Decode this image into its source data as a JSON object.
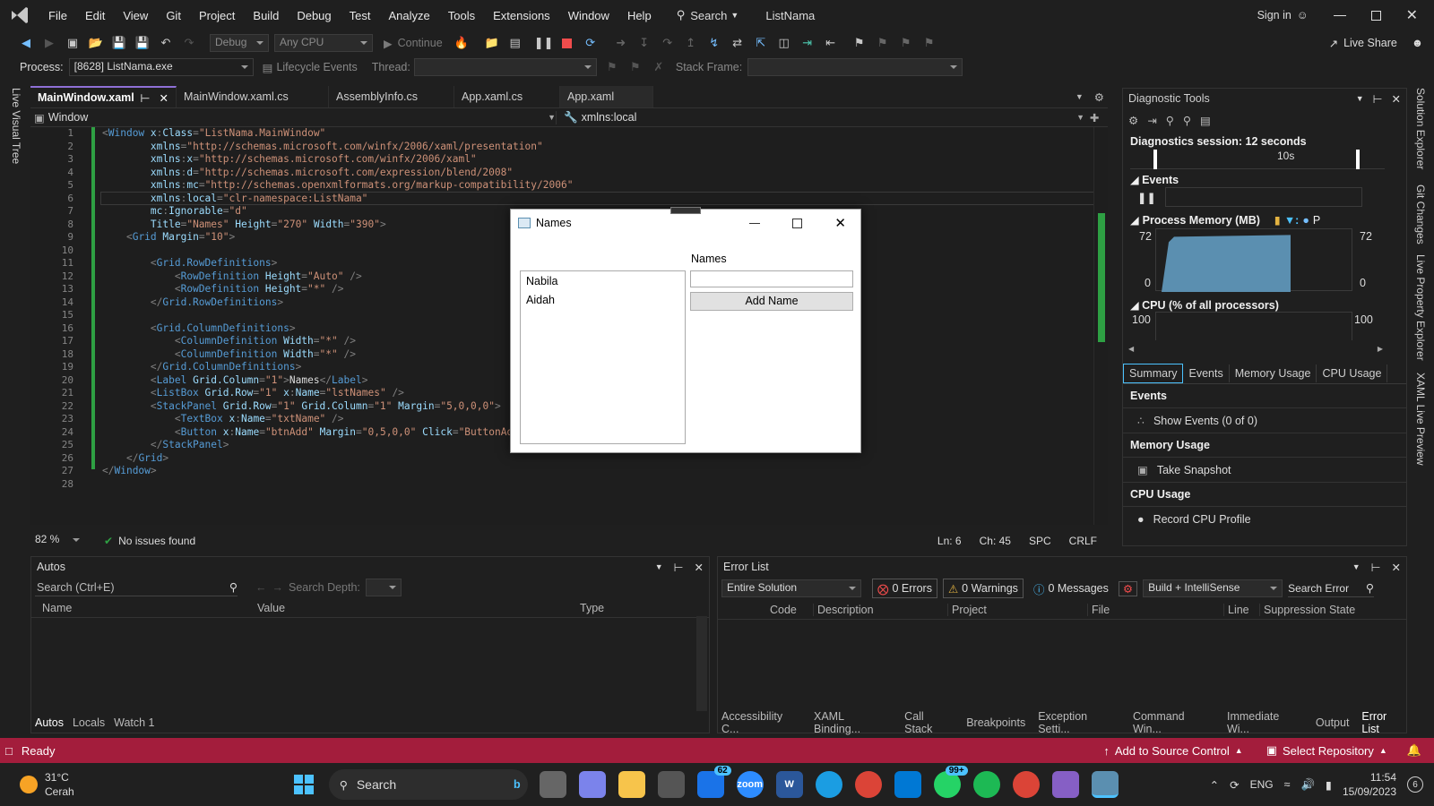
{
  "menu": [
    "File",
    "Edit",
    "View",
    "Git",
    "Project",
    "Build",
    "Debug",
    "Test",
    "Analyze",
    "Tools",
    "Extensions",
    "Window",
    "Help"
  ],
  "search_label": "Search",
  "solution_name": "ListNama",
  "sign_in": "Sign in",
  "live_share": "Live Share",
  "toolbar": {
    "config": "Debug",
    "platform": "Any CPU",
    "continue": "Continue"
  },
  "process_bar": {
    "process_label": "Process:",
    "process_value": "[8628] ListNama.exe",
    "lifecycle": "Lifecycle Events",
    "thread": "Thread:",
    "stack_frame": "Stack Frame:"
  },
  "left_strip": "Live Visual Tree",
  "tabs": [
    "MainWindow.xaml",
    "MainWindow.xaml.cs",
    "AssemblyInfo.cs",
    "App.xaml.cs",
    "App.xaml"
  ],
  "nav": {
    "left": "Window",
    "right": "xmlns:local"
  },
  "code_lines": [
    [
      [
        "t-p",
        "<"
      ],
      [
        "t-el",
        "Window "
      ],
      [
        "t-at",
        "x"
      ],
      [
        "t-p",
        ":"
      ],
      [
        "t-at",
        "Class"
      ],
      [
        "t-p",
        "="
      ],
      [
        "t-val",
        "\"ListNama.MainWindow\""
      ]
    ],
    [
      [
        "t-txt",
        "        "
      ],
      [
        "t-at",
        "xmlns"
      ],
      [
        "t-p",
        "="
      ],
      [
        "t-val",
        "\"http://schemas.microsoft.com/winfx/2006/xaml/presentation\""
      ]
    ],
    [
      [
        "t-txt",
        "        "
      ],
      [
        "t-at",
        "xmlns"
      ],
      [
        "t-p",
        ":"
      ],
      [
        "t-at",
        "x"
      ],
      [
        "t-p",
        "="
      ],
      [
        "t-val",
        "\"http://schemas.microsoft.com/winfx/2006/xaml\""
      ]
    ],
    [
      [
        "t-txt",
        "        "
      ],
      [
        "t-at",
        "xmlns"
      ],
      [
        "t-p",
        ":"
      ],
      [
        "t-at",
        "d"
      ],
      [
        "t-p",
        "="
      ],
      [
        "t-val",
        "\"http://schemas.microsoft.com/expression/blend/2008\""
      ]
    ],
    [
      [
        "t-txt",
        "        "
      ],
      [
        "t-at",
        "xmlns"
      ],
      [
        "t-p",
        ":"
      ],
      [
        "t-at",
        "mc"
      ],
      [
        "t-p",
        "="
      ],
      [
        "t-val",
        "\"http://schemas.openxmlformats.org/markup-compatibility/2006\""
      ]
    ],
    [
      [
        "t-txt",
        "        "
      ],
      [
        "t-at",
        "xmlns"
      ],
      [
        "t-p",
        ":"
      ],
      [
        "t-at",
        "local"
      ],
      [
        "t-p",
        "="
      ],
      [
        "t-val",
        "\"clr-namespace:ListNama\""
      ]
    ],
    [
      [
        "t-txt",
        "        "
      ],
      [
        "t-at",
        "mc"
      ],
      [
        "t-p",
        ":"
      ],
      [
        "t-at",
        "Ignorable"
      ],
      [
        "t-p",
        "="
      ],
      [
        "t-val",
        "\"d\""
      ]
    ],
    [
      [
        "t-txt",
        "        "
      ],
      [
        "t-at",
        "Title"
      ],
      [
        "t-p",
        "="
      ],
      [
        "t-val",
        "\"Names\""
      ],
      [
        "t-txt",
        " "
      ],
      [
        "t-at",
        "Height"
      ],
      [
        "t-p",
        "="
      ],
      [
        "t-val",
        "\"270\""
      ],
      [
        "t-txt",
        " "
      ],
      [
        "t-at",
        "Width"
      ],
      [
        "t-p",
        "="
      ],
      [
        "t-val",
        "\"390\""
      ],
      [
        "t-p",
        ">"
      ]
    ],
    [
      [
        "t-txt",
        "    "
      ],
      [
        "t-p",
        "<"
      ],
      [
        "t-el",
        "Grid "
      ],
      [
        "t-at",
        "Margin"
      ],
      [
        "t-p",
        "="
      ],
      [
        "t-val",
        "\"10\""
      ],
      [
        "t-p",
        ">"
      ]
    ],
    [],
    [
      [
        "t-txt",
        "        "
      ],
      [
        "t-p",
        "<"
      ],
      [
        "t-el",
        "Grid.RowDefinitions"
      ],
      [
        "t-p",
        ">"
      ]
    ],
    [
      [
        "t-txt",
        "            "
      ],
      [
        "t-p",
        "<"
      ],
      [
        "t-el",
        "RowDefinition "
      ],
      [
        "t-at",
        "Height"
      ],
      [
        "t-p",
        "="
      ],
      [
        "t-val",
        "\"Auto\""
      ],
      [
        "t-p",
        " />"
      ]
    ],
    [
      [
        "t-txt",
        "            "
      ],
      [
        "t-p",
        "<"
      ],
      [
        "t-el",
        "RowDefinition "
      ],
      [
        "t-at",
        "Height"
      ],
      [
        "t-p",
        "="
      ],
      [
        "t-val",
        "\"*\""
      ],
      [
        "t-p",
        " />"
      ]
    ],
    [
      [
        "t-txt",
        "        "
      ],
      [
        "t-p",
        "</"
      ],
      [
        "t-el",
        "Grid.RowDefinitions"
      ],
      [
        "t-p",
        ">"
      ]
    ],
    [],
    [
      [
        "t-txt",
        "        "
      ],
      [
        "t-p",
        "<"
      ],
      [
        "t-el",
        "Grid.ColumnDefinitions"
      ],
      [
        "t-p",
        ">"
      ]
    ],
    [
      [
        "t-txt",
        "            "
      ],
      [
        "t-p",
        "<"
      ],
      [
        "t-el",
        "ColumnDefinition "
      ],
      [
        "t-at",
        "Width"
      ],
      [
        "t-p",
        "="
      ],
      [
        "t-val",
        "\"*\""
      ],
      [
        "t-p",
        " />"
      ]
    ],
    [
      [
        "t-txt",
        "            "
      ],
      [
        "t-p",
        "<"
      ],
      [
        "t-el",
        "ColumnDefinition "
      ],
      [
        "t-at",
        "Width"
      ],
      [
        "t-p",
        "="
      ],
      [
        "t-val",
        "\"*\""
      ],
      [
        "t-p",
        " />"
      ]
    ],
    [
      [
        "t-txt",
        "        "
      ],
      [
        "t-p",
        "</"
      ],
      [
        "t-el",
        "Grid.ColumnDefinitions"
      ],
      [
        "t-p",
        ">"
      ]
    ],
    [
      [
        "t-txt",
        "        "
      ],
      [
        "t-p",
        "<"
      ],
      [
        "t-el",
        "Label "
      ],
      [
        "t-at",
        "Grid.Column"
      ],
      [
        "t-p",
        "="
      ],
      [
        "t-val",
        "\"1\""
      ],
      [
        "t-p",
        ">"
      ],
      [
        "t-txt",
        "Names"
      ],
      [
        "t-p",
        "</"
      ],
      [
        "t-el",
        "Label"
      ],
      [
        "t-p",
        ">"
      ]
    ],
    [
      [
        "t-txt",
        "        "
      ],
      [
        "t-p",
        "<"
      ],
      [
        "t-el",
        "ListBox "
      ],
      [
        "t-at",
        "Grid.Row"
      ],
      [
        "t-p",
        "="
      ],
      [
        "t-val",
        "\"1\""
      ],
      [
        "t-txt",
        " "
      ],
      [
        "t-at",
        "x"
      ],
      [
        "t-p",
        ":"
      ],
      [
        "t-at",
        "Name"
      ],
      [
        "t-p",
        "="
      ],
      [
        "t-val",
        "\"lstNames\""
      ],
      [
        "t-p",
        " />"
      ]
    ],
    [
      [
        "t-txt",
        "        "
      ],
      [
        "t-p",
        "<"
      ],
      [
        "t-el",
        "StackPanel "
      ],
      [
        "t-at",
        "Grid.Row"
      ],
      [
        "t-p",
        "="
      ],
      [
        "t-val",
        "\"1\""
      ],
      [
        "t-txt",
        " "
      ],
      [
        "t-at",
        "Grid.Column"
      ],
      [
        "t-p",
        "="
      ],
      [
        "t-val",
        "\"1\""
      ],
      [
        "t-txt",
        " "
      ],
      [
        "t-at",
        "Margin"
      ],
      [
        "t-p",
        "="
      ],
      [
        "t-val",
        "\"5,0,0,0\""
      ],
      [
        "t-p",
        ">"
      ]
    ],
    [
      [
        "t-txt",
        "            "
      ],
      [
        "t-p",
        "<"
      ],
      [
        "t-el",
        "TextBox "
      ],
      [
        "t-at",
        "x"
      ],
      [
        "t-p",
        ":"
      ],
      [
        "t-at",
        "Name"
      ],
      [
        "t-p",
        "="
      ],
      [
        "t-val",
        "\"txtName\""
      ],
      [
        "t-p",
        " />"
      ]
    ],
    [
      [
        "t-txt",
        "            "
      ],
      [
        "t-p",
        "<"
      ],
      [
        "t-el",
        "Button "
      ],
      [
        "t-at",
        "x"
      ],
      [
        "t-p",
        ":"
      ],
      [
        "t-at",
        "Name"
      ],
      [
        "t-p",
        "="
      ],
      [
        "t-val",
        "\"btnAdd\""
      ],
      [
        "t-txt",
        " "
      ],
      [
        "t-at",
        "Margin"
      ],
      [
        "t-p",
        "="
      ],
      [
        "t-val",
        "\"0,5,0,0\""
      ],
      [
        "t-txt",
        " "
      ],
      [
        "t-at",
        "Click"
      ],
      [
        "t-p",
        "="
      ],
      [
        "t-val",
        "\"ButtonAddN"
      ]
    ],
    [
      [
        "t-txt",
        "        "
      ],
      [
        "t-p",
        "</"
      ],
      [
        "t-el",
        "StackPanel"
      ],
      [
        "t-p",
        ">"
      ]
    ],
    [
      [
        "t-txt",
        "    "
      ],
      [
        "t-p",
        "</"
      ],
      [
        "t-el",
        "Grid"
      ],
      [
        "t-p",
        ">"
      ]
    ],
    [
      [
        "t-p",
        "</"
      ],
      [
        "t-el",
        "Window"
      ],
      [
        "t-p",
        ">"
      ]
    ],
    []
  ],
  "editor_status": {
    "zoom": "82 %",
    "issues": "No issues found",
    "ln": "Ln: 6",
    "ch": "Ch: 45",
    "spc": "SPC",
    "crlf": "CRLF"
  },
  "diag": {
    "title": "Diagnostic Tools",
    "session": "Diagnostics session: 12 seconds",
    "timeline_tick": "10s",
    "events": "Events",
    "process_memory": "Process Memory (MB)",
    "mem_legend_p": "P",
    "mem_max": "72",
    "mem_min": "0",
    "memory_level": 0.88,
    "cpu": "CPU (% of all processors)",
    "cpu_max": "100",
    "tabs": [
      "Summary",
      "Events",
      "Memory Usage",
      "CPU Usage"
    ],
    "sum_events": "Events",
    "show_events": "Show Events (0 of 0)",
    "sum_memory": "Memory Usage",
    "take_snapshot": "Take Snapshot",
    "sum_cpu": "CPU Usage",
    "record_cpu": "Record CPU Profile"
  },
  "right_strip": [
    "Solution Explorer",
    "Git Changes",
    "Live Property Explorer",
    "XAML Live Preview"
  ],
  "names_window": {
    "title": "Names",
    "label": "Names",
    "items": [
      "Nabila",
      "Aidah"
    ],
    "textbox_value": "",
    "button": "Add Name"
  },
  "autos": {
    "title": "Autos",
    "search": "Search (Ctrl+E)",
    "search_depth": "Search Depth:",
    "cols": [
      "Name",
      "Value",
      "Type"
    ],
    "tabs": [
      "Autos",
      "Locals",
      "Watch 1"
    ]
  },
  "errors": {
    "title": "Error List",
    "scope": "Entire Solution",
    "errors": "0 Errors",
    "warnings": "0 Warnings",
    "messages": "0 Messages",
    "build": "Build + IntelliSense",
    "search": "Search Error",
    "cols": [
      "Code",
      "Description",
      "Project",
      "File",
      "Line",
      "Suppression State"
    ],
    "tabs": [
      "Accessibility C...",
      "XAML Binding...",
      "Call Stack",
      "Breakpoints",
      "Exception Setti...",
      "Command Win...",
      "Immediate Wi...",
      "Output",
      "Error List"
    ]
  },
  "status": {
    "ready": "Ready",
    "add_source": "Add to Source Control",
    "select_repo": "Select Repository"
  },
  "taskbar": {
    "temp": "31°C",
    "weather": "Cerah",
    "search": "Search",
    "lang": "ENG",
    "time": "11:54",
    "date": "15/09/2023",
    "mail_badge": "62",
    "whatsapp_badge": "99+",
    "notif": "6"
  },
  "colors": {
    "accent": "#8e6fd6",
    "status": "#a31d3c",
    "memory": "#5b8fb0"
  }
}
